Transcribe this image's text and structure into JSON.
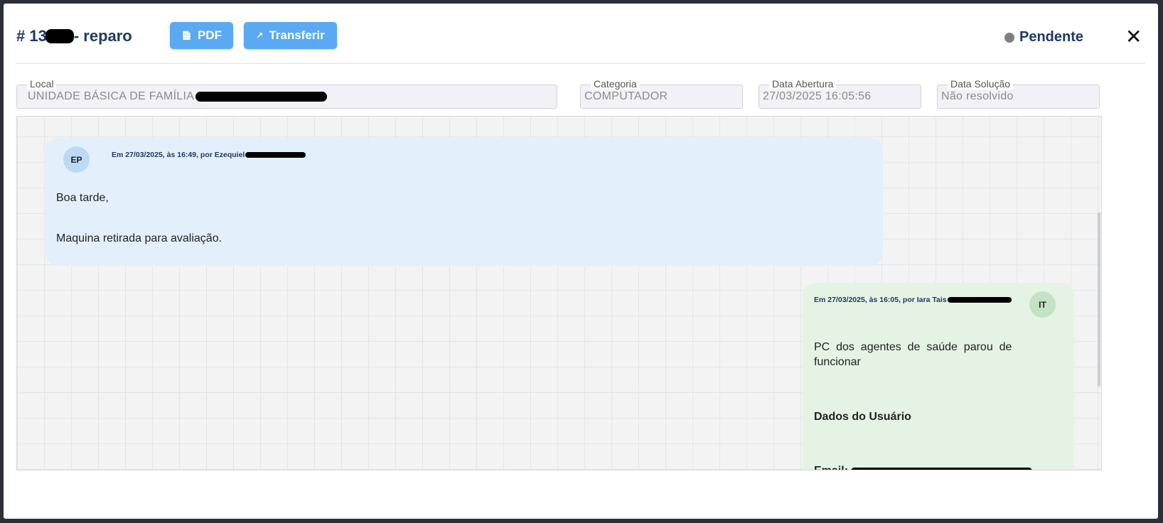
{
  "header": {
    "title_prefix": "# 13",
    "title_suffix": "- reparo",
    "pdf_label": "PDF",
    "transfer_label": "Transferir",
    "status_label": "Pendente",
    "close_label": "✕"
  },
  "fields": {
    "local": {
      "label": "Local",
      "value": "UNIDADE BÁSICA DE FAMÍLIA"
    },
    "categoria": {
      "label": "Categoria",
      "value": "COMPUTADOR"
    },
    "data_abertura": {
      "label": "Data Abertura",
      "value": "27/03/2025 16:05:56"
    },
    "data_solucao": {
      "label": "Data Solução",
      "value": "Não resolvido"
    }
  },
  "messages": {
    "tech": {
      "initials": "EP",
      "meta": "Em 27/03/2025, às 16:49, por Ezequiel",
      "line1": "Boa tarde,",
      "line2": "Maquina retirada para avaliação."
    },
    "user": {
      "initials": "IT",
      "meta": "Em 27/03/2025, às 16:05, por Iara Tais",
      "line1": "PC  dos  agentes  de  saúde  parou  de",
      "line2": "funcionar",
      "heading": "Dados do Usuário",
      "email_label": "Email:"
    }
  },
  "colors": {
    "accent": "#5aa9f2",
    "title": "#1e3a66",
    "status_dot": "#7f7f7f"
  },
  "icons": {
    "pdf": "pdf-file-icon",
    "transfer": "share-icon",
    "close": "close-icon"
  }
}
